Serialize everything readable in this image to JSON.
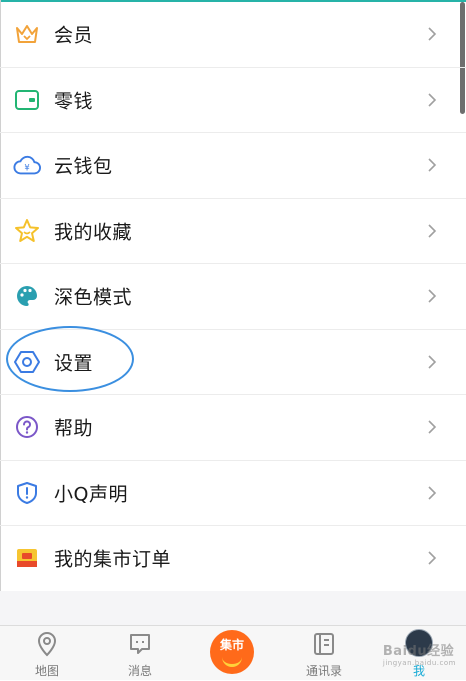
{
  "menu": {
    "items": [
      {
        "label": "会员",
        "icon": "crown-icon",
        "color": "#f2a33a"
      },
      {
        "label": "零钱",
        "icon": "wallet-icon",
        "color": "#22b573"
      },
      {
        "label": "云钱包",
        "icon": "cloud-wallet-icon",
        "color": "#3b7be3"
      },
      {
        "label": "我的收藏",
        "icon": "star-icon",
        "color": "#f5c12a"
      },
      {
        "label": "深色模式",
        "icon": "palette-icon",
        "color": "#2a9fb0"
      },
      {
        "label": "设置",
        "icon": "settings-hexagon-icon",
        "color": "#3b7be3"
      },
      {
        "label": "帮助",
        "icon": "help-icon",
        "color": "#7b57c8"
      },
      {
        "label": "小Q声明",
        "icon": "shield-icon",
        "color": "#3b7be3"
      },
      {
        "label": "我的集市订单",
        "icon": "market-order-icon",
        "color": "#e84a2a"
      }
    ]
  },
  "tabbar": {
    "tabs": [
      {
        "label": "地图",
        "icon": "map-pin-icon"
      },
      {
        "label": "消息",
        "icon": "message-icon"
      },
      {
        "label": "集市",
        "icon": "market-icon"
      },
      {
        "label": "通讯录",
        "icon": "contacts-icon"
      },
      {
        "label": "我",
        "icon": "avatar-icon"
      }
    ]
  },
  "watermark": {
    "text": "Baidu经验",
    "sub": "jingyan.baidu.com"
  },
  "colors": {
    "accent": "#14a9d5",
    "highlight": "#3b8fe0",
    "market": "#ff6a1a"
  }
}
